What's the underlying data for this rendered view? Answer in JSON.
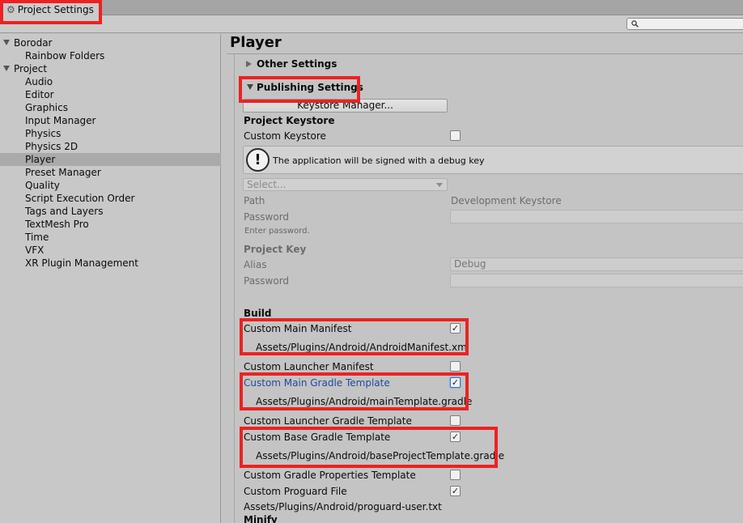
{
  "window": {
    "tab_title": "Project Settings",
    "search_placeholder": ""
  },
  "sidebar": {
    "groups": [
      {
        "label": "Borodar",
        "items": [
          "Rainbow Folders"
        ]
      },
      {
        "label": "Project",
        "items": [
          "Audio",
          "Editor",
          "Graphics",
          "Input Manager",
          "Physics",
          "Physics 2D",
          "Player",
          "Preset Manager",
          "Quality",
          "Script Execution Order",
          "Tags and Layers",
          "TextMesh Pro",
          "Time",
          "VFX",
          "XR Plugin Management"
        ]
      }
    ],
    "selected": "Player"
  },
  "main": {
    "title": "Player",
    "other_settings": "Other Settings",
    "publishing_settings": "Publishing Settings",
    "keystore_button": "Keystore Manager...",
    "project_keystore": {
      "heading": "Project Keystore",
      "custom_keystore": "Custom Keystore",
      "help_text": "The application will be signed with a debug key",
      "select_placeholder": "Select...",
      "path_label": "Path",
      "path_value": "Development Keystore",
      "password_label": "Password",
      "password_hint": "Enter password."
    },
    "project_key": {
      "heading": "Project Key",
      "alias_label": "Alias",
      "alias_value": "Debug",
      "password_label": "Password"
    },
    "build": {
      "heading": "Build",
      "custom_main_manifest": {
        "label": "Custom Main Manifest",
        "checked": true,
        "path": "Assets/Plugins/Android/AndroidManifest.xml"
      },
      "custom_launcher_manifest": {
        "label": "Custom Launcher Manifest",
        "checked": false
      },
      "custom_main_gradle": {
        "label": "Custom Main Gradle Template",
        "checked": true,
        "path": "Assets/Plugins/Android/mainTemplate.gradle"
      },
      "custom_launcher_gradle": {
        "label": "Custom Launcher Gradle Template",
        "checked": false
      },
      "custom_base_gradle": {
        "label": "Custom Base Gradle Template",
        "checked": true,
        "path": "Assets/Plugins/Android/baseProjectTemplate.gradle"
      },
      "custom_gradle_properties": {
        "label": "Custom Gradle Properties Template",
        "checked": false
      },
      "custom_proguard": {
        "label": "Custom Proguard File",
        "checked": true,
        "path": "Assets/Plugins/Android/proguard-user.txt"
      }
    },
    "minify_heading": "Minify"
  },
  "check_glyph": "✓",
  "colors": {
    "highlight": "#ec2222",
    "link": "#1a4c9c",
    "selection": "#aaaaaa"
  }
}
